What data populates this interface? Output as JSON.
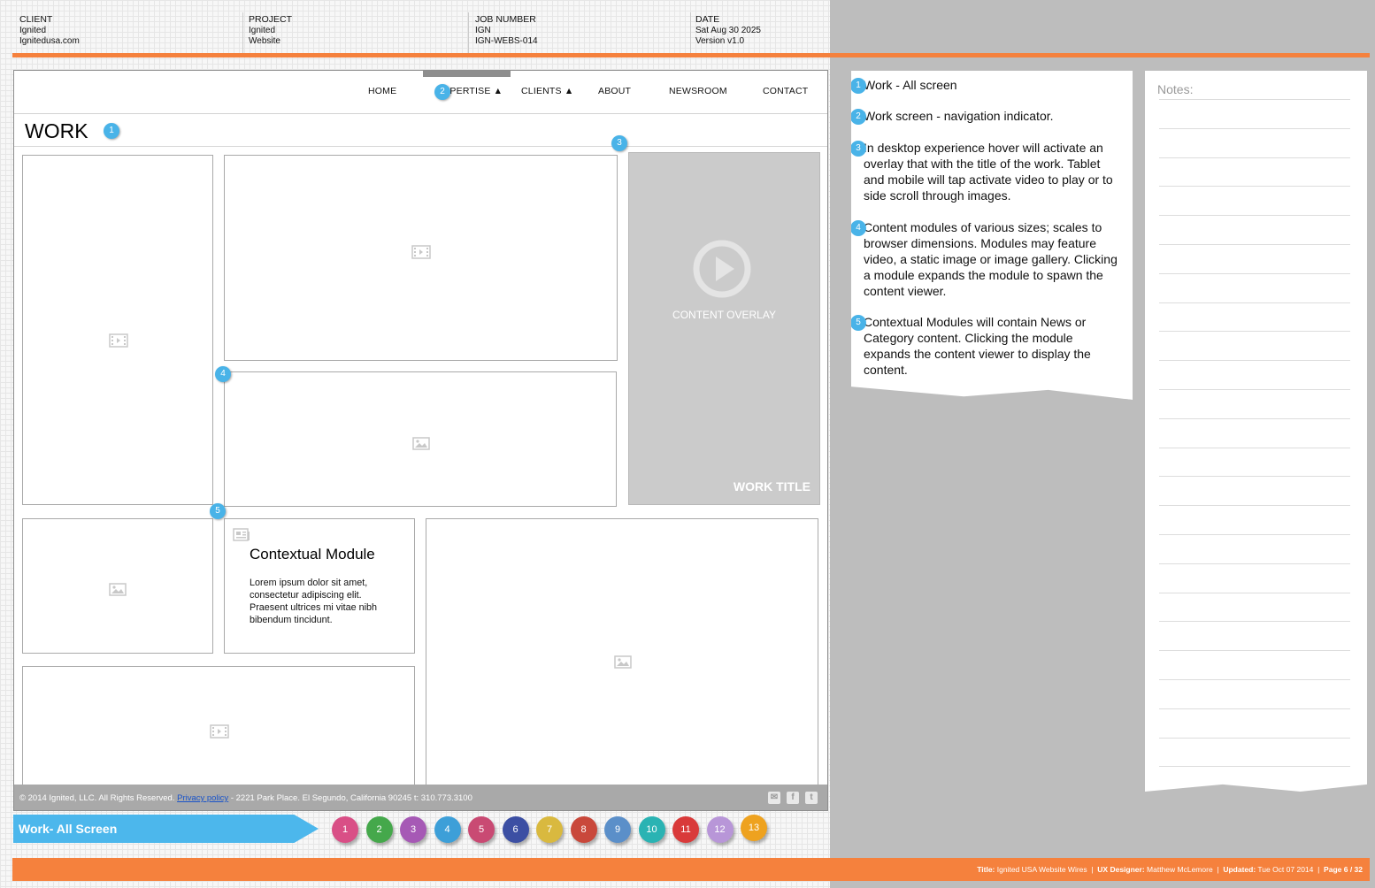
{
  "header": {
    "client_label": "CLIENT",
    "client_name": "Ignited",
    "client_site": "Ignitedusa.com",
    "project_label": "PROJECT",
    "project_name": "Ignited",
    "project_type": "Website",
    "job_label": "JOB NUMBER",
    "job_code": "IGN",
    "job_number": "IGN-WEBS-014",
    "date_label": "DATE",
    "date_value": "Sat Aug 30 2025",
    "version": "Version v1.0"
  },
  "nav": {
    "items": [
      {
        "label": "HOME"
      },
      {
        "label": "EXPERTISE ▲"
      },
      {
        "label": "CLIENTS ▲"
      },
      {
        "label": "ABOUT"
      },
      {
        "label": "NEWSROOM"
      },
      {
        "label": "CONTACT"
      }
    ]
  },
  "page": {
    "heading": "WORK",
    "overlay_label": "CONTENT OVERLAY",
    "work_title": "WORK TITLE",
    "contextual_title": "Contextual Module",
    "contextual_body": "Lorem ipsum dolor sit amet, consectetur adipiscing elit. Praesent ultrices mi vitae nibh bibendum tincidunt."
  },
  "footer": {
    "copyright": "© 2014 Ignited, LLC. All Rights Reserved.",
    "privacy_link": "Privacy policy",
    "address": " -  2221 Park Place. El Segundo, California 90245 t: 310.773.3100",
    "social_icons": [
      "mail-icon",
      "facebook-icon",
      "twitter-icon"
    ]
  },
  "markers": [
    "1",
    "2",
    "3",
    "4",
    "5"
  ],
  "annotations": [
    {
      "num": "1",
      "text": "Work - All screen"
    },
    {
      "num": "2",
      "text": "Work screen - navigation indicator."
    },
    {
      "num": "3",
      "text": "In desktop experience hover will activate an overlay that with the title of the work. Tablet and mobile will tap activate video to play or to side scroll through images."
    },
    {
      "num": "4",
      "text": "Content modules of various sizes; scales to browser dimensions. Modules may feature video, a static image or image gallery. Clicking a module expands the module to spawn the content viewer."
    },
    {
      "num": "5",
      "text": "Contextual Modules will contain News or Category content. Clicking the module expands the content viewer to display the content."
    }
  ],
  "notes": {
    "title": "Notes:"
  },
  "screen_banner": "Work- All  Screen",
  "pager": [
    {
      "num": "1",
      "color": "#d94f86"
    },
    {
      "num": "2",
      "color": "#45a84b"
    },
    {
      "num": "3",
      "color": "#a659b5"
    },
    {
      "num": "4",
      "color": "#3d9fd8"
    },
    {
      "num": "5",
      "color": "#c94a73"
    },
    {
      "num": "6",
      "color": "#3c4fa3"
    },
    {
      "num": "7",
      "color": "#d9b93f"
    },
    {
      "num": "8",
      "color": "#c9483b"
    },
    {
      "num": "9",
      "color": "#5b8fc9"
    },
    {
      "num": "10",
      "color": "#2ab3b3"
    },
    {
      "num": "11",
      "color": "#d93a3a"
    },
    {
      "num": "12",
      "color": "#b896d8"
    },
    {
      "num": "13",
      "color": "#eea21f"
    }
  ],
  "bottom_bar": {
    "title_label": "Title:",
    "title_value": " Ignited USA Website Wires",
    "designer_label": "UX Designer:",
    "designer_value": " Matthew McLemore",
    "updated_label": "Updated:",
    "updated_value": " Tue Oct 07 2014",
    "page_value": "Page 6 / 32"
  },
  "colors": {
    "accent_orange": "#f5813d",
    "marker_blue": "#49b3e8"
  }
}
